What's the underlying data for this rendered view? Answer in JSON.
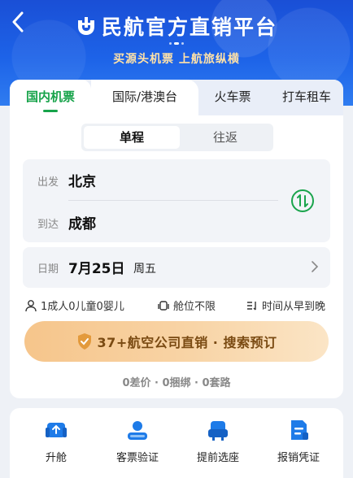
{
  "header": {
    "title": "民航官方直销平台",
    "subtitle": "买源头机票 上航旅纵横",
    "back_icon": "chevron-left-icon",
    "logo_icon": "airline-logo-icon"
  },
  "tabs": [
    {
      "label": "国内机票",
      "active": true
    },
    {
      "label": "国际/港澳台",
      "active": false
    },
    {
      "label": "火车票",
      "active": false
    },
    {
      "label": "打车租车",
      "active": false
    }
  ],
  "trip_type": {
    "one_way": "单程",
    "round_trip": "往返",
    "selected": "单程"
  },
  "route": {
    "from_label": "出发",
    "from_city": "北京",
    "to_label": "到达",
    "to_city": "成都",
    "swap_icon": "swap-arrows-icon"
  },
  "date": {
    "label": "日期",
    "value": "7月25日",
    "weekday": "周五"
  },
  "options": {
    "passengers": "1成人0儿童0婴儿",
    "cabin": "舱位不限",
    "sort": "时间从早到晚"
  },
  "search_button": {
    "label": "37+航空公司直销 · 搜索预订",
    "icon": "shield-check-icon"
  },
  "guarantee": "0差价 · 0捆绑 · 0套路",
  "services": [
    {
      "label": "升舱",
      "icon": "upgrade-seat-icon"
    },
    {
      "label": "客票验证",
      "icon": "ticket-verify-icon"
    },
    {
      "label": "提前选座",
      "icon": "seat-select-icon"
    },
    {
      "label": "报销凭证",
      "icon": "receipt-icon"
    }
  ],
  "colors": {
    "header_blue": "#1d63e8",
    "accent_green": "#17a34a",
    "search_gold": "#f6c58b",
    "icon_blue": "#1e7be8"
  }
}
